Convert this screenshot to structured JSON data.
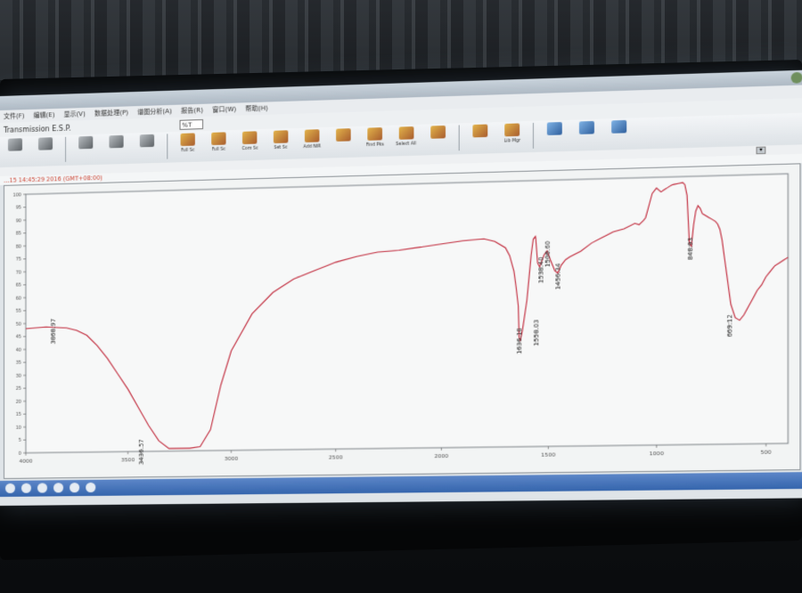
{
  "app": {
    "window_title": "Transmission E.S.P.",
    "menus": [
      "文件(F)",
      "编辑(E)",
      "显示(V)",
      "数据处理(P)",
      "谱图分析(A)",
      "报告(R)",
      "窗口(W)",
      "帮助(H)"
    ],
    "unit_select": "%T",
    "toolbar": [
      {
        "label": "",
        "icon": "arrow-icon"
      },
      {
        "label": "",
        "icon": "arrow-icon"
      },
      {
        "label": "",
        "icon": "open-icon"
      },
      {
        "label": "",
        "icon": "save-icon"
      },
      {
        "label": "",
        "icon": "print-icon"
      },
      {
        "label": "Full Sc",
        "icon": "full-scale-icon"
      },
      {
        "label": "Full Sc",
        "icon": "full-scale-icon"
      },
      {
        "label": "Com Sc",
        "icon": "common-scale-icon"
      },
      {
        "label": "Set Sc",
        "icon": "set-scale-icon"
      },
      {
        "label": "Add NIR",
        "icon": "nir-icon"
      },
      {
        "label": "",
        "icon": "peak-icon"
      },
      {
        "label": "Find Pks",
        "icon": "find-peaks-icon"
      },
      {
        "label": "Select All",
        "icon": "select-all-icon"
      },
      {
        "label": "",
        "icon": "report-icon"
      },
      {
        "label": "",
        "icon": "zoom-icon"
      },
      {
        "label": "Lib Mgr",
        "icon": "library-icon"
      },
      {
        "label": "",
        "icon": "library-search-icon"
      },
      {
        "label": "",
        "icon": "library-search-icon"
      },
      {
        "label": "",
        "icon": "library-search-icon"
      }
    ],
    "info_line": "…15 14:45:29 2016 (GMT+08:00)"
  },
  "chart_data": {
    "type": "line",
    "x_reversed": true,
    "xlim": [
      4000,
      400
    ],
    "ylim": [
      0,
      100
    ],
    "x_ticks": [
      4000,
      3500,
      3000,
      2500,
      2000,
      1500,
      1000,
      500
    ],
    "y_ticks": [
      100,
      95,
      90,
      85,
      80,
      75,
      70,
      65,
      60,
      55,
      50,
      45,
      40,
      35,
      30,
      25,
      20,
      15,
      10,
      5,
      0
    ],
    "series": [
      {
        "color": "#c0283a",
        "x": [
          4000,
          3900,
          3800,
          3750,
          3700,
          3650,
          3600,
          3550,
          3500,
          3450,
          3400,
          3350,
          3300,
          3250,
          3200,
          3150,
          3100,
          3050,
          3000,
          2900,
          2800,
          2700,
          2600,
          2500,
          2400,
          2300,
          2200,
          2100,
          2000,
          1900,
          1800,
          1750,
          1700,
          1680,
          1660,
          1650,
          1640,
          1636,
          1630,
          1620,
          1600,
          1580,
          1570,
          1560,
          1558,
          1550,
          1540,
          1538,
          1520,
          1506,
          1490,
          1470,
          1456,
          1440,
          1420,
          1400,
          1350,
          1300,
          1250,
          1200,
          1150,
          1100,
          1080,
          1060,
          1050,
          1040,
          1020,
          1000,
          980,
          960,
          950,
          940,
          930,
          920,
          900,
          880,
          870,
          860,
          849,
          840,
          830,
          820,
          810,
          800,
          790,
          780,
          770,
          760,
          750,
          740,
          730,
          720,
          710,
          700,
          690,
          680,
          670,
          660,
          640,
          620,
          600,
          580,
          560,
          540,
          520,
          500,
          480,
          460,
          440,
          420,
          400
        ],
        "y": [
          48,
          48.5,
          48,
          47,
          45,
          41,
          36,
          30,
          24,
          17,
          10,
          4,
          1,
          1,
          1,
          1.5,
          8,
          25,
          38,
          52,
          60,
          65,
          68,
          71,
          73,
          74.5,
          75,
          76,
          77,
          78,
          78.5,
          77.5,
          75,
          72,
          66,
          60,
          53,
          41,
          40,
          44,
          55,
          72,
          78,
          79,
          78,
          69,
          67.5,
          68,
          72,
          73.5,
          70,
          66,
          65,
          68,
          70,
          71,
          73,
          76,
          78,
          80,
          81,
          83,
          82.5,
          84,
          85,
          88,
          94,
          96,
          94.5,
          95.5,
          96,
          96.5,
          97,
          97.2,
          97.5,
          97.8,
          97,
          93,
          75,
          74,
          82,
          87,
          89,
          88,
          86,
          85.5,
          85,
          84.5,
          84,
          83.5,
          83,
          82,
          80,
          76,
          70,
          64,
          58,
          52,
          47,
          46,
          48,
          51,
          54,
          57,
          59,
          62,
          64,
          66,
          67,
          68,
          69
        ]
      }
    ],
    "peak_labels": [
      {
        "x": 3868,
        "label": "3868.97",
        "y": 48
      },
      {
        "x": 3436,
        "label": "3436.57",
        "y": 1
      },
      {
        "x": 1636,
        "label": "1636.18",
        "y": 41
      },
      {
        "x": 1558,
        "label": "1558.03",
        "y": 44
      },
      {
        "x": 1538,
        "label": "1538.40",
        "y": 67.5
      },
      {
        "x": 1506,
        "label": "1506.60",
        "y": 73.5
      },
      {
        "x": 1456,
        "label": "1456.34",
        "y": 65
      },
      {
        "x": 849,
        "label": "848.93",
        "y": 75
      },
      {
        "x": 669,
        "label": "669.12",
        "y": 46
      }
    ],
    "title": "",
    "xlabel": "",
    "ylabel": ""
  }
}
